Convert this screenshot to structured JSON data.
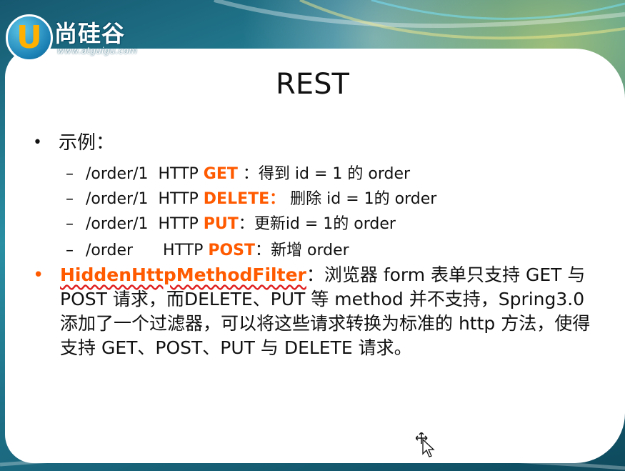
{
  "logo": {
    "letter": "U",
    "name": "尚硅谷",
    "url": "www.atguigu.com"
  },
  "slide": {
    "title": "REST",
    "example_heading": "示例：",
    "examples": [
      {
        "path": "/order/1",
        "protocol": "HTTP",
        "method": "GET",
        "sep": "：",
        "desc": "得到 id = 1 的 order"
      },
      {
        "path": "/order/1",
        "protocol": "HTTP",
        "method": "DELETE：",
        "sep": "",
        "desc": "删除 id = 1的 order"
      },
      {
        "path": "/order/1",
        "protocol": "HTTP",
        "method": "PUT",
        "sep": "：",
        "desc": "更新id = 1的 order"
      },
      {
        "path": "/order",
        "protocol": "HTTP",
        "method": "POST",
        "sep": "：",
        "desc": "新增 order"
      }
    ],
    "filter_name": "HiddenHttpMethodFilter",
    "filter_desc": "：浏览器 form 表单只支持 GET 与 POST 请求，而DELETE、PUT 等 method 并不支持，Spring3.0 添加了一个过滤器，可以将这些请求转换为标准的 http 方法，使得支持 GET、POST、PUT 与 DELETE 请求。"
  },
  "colors": {
    "accent": "#ff5a00",
    "background": "#1f6f8a"
  }
}
